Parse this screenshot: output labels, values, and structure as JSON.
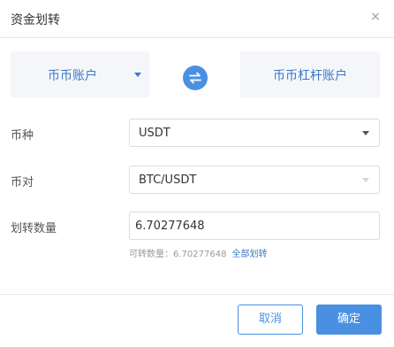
{
  "dialog": {
    "title": "资金划转",
    "close_glyph": "×"
  },
  "transfer": {
    "from_account": "币币账户",
    "to_account": "币币杠杆账户",
    "swap_icon": "swap-arrows-icon"
  },
  "form": {
    "currency_label": "币种",
    "currency_value": "USDT",
    "pair_label": "币对",
    "pair_value": "BTC/USDT",
    "amount_label": "划转数量",
    "amount_value": "6.70277648",
    "available_text": "可转数量：6.70277648",
    "transfer_all": "全部划转"
  },
  "buttons": {
    "cancel": "取消",
    "confirm": "确定"
  },
  "colors": {
    "accent": "#4a90e2",
    "link": "#3b78c6",
    "panel_bg": "#f5f6fa"
  }
}
